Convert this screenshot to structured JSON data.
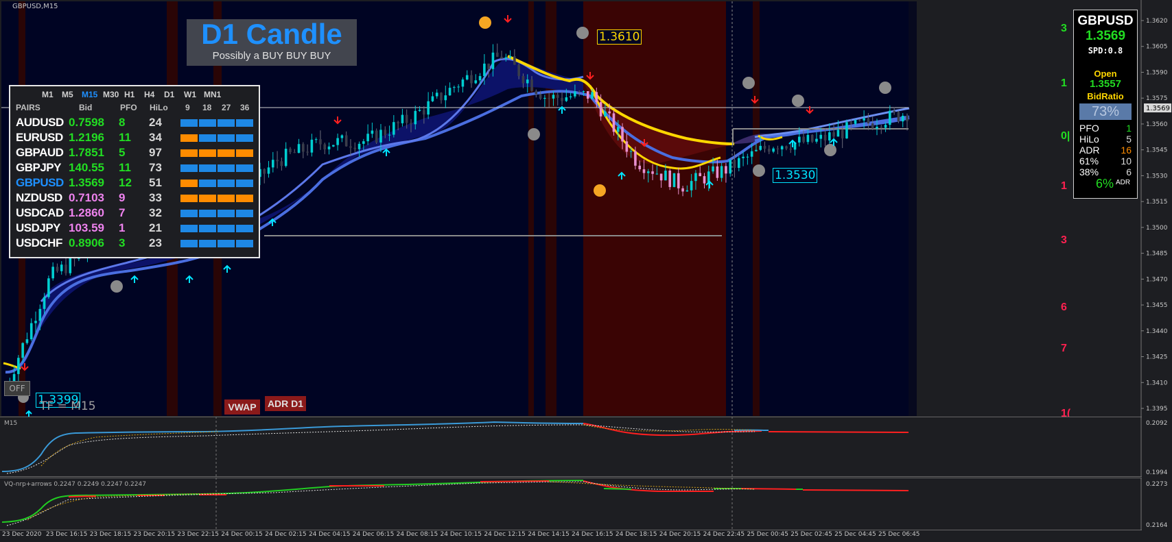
{
  "chart_title": "GBPUSD,M15",
  "banner": {
    "title": "D1 Candle",
    "subtitle": "Possibly a BUY BUY BUY"
  },
  "off_button": "OFF",
  "tf_label": "TF = M15",
  "vwap_button": "VWAP",
  "adr_button": "ADR D1",
  "price_tags": {
    "high": "1.3610",
    "mid": "1.3530",
    "low": "1.3399"
  },
  "right_markers": [
    "3",
    "1",
    "0|",
    "1",
    "3",
    "6",
    "7",
    "1("
  ],
  "price_axis": [
    "1.3620",
    "1.3605",
    "1.3590",
    "1.3575",
    "1.3560",
    "1.3545",
    "1.3530",
    "1.3515",
    "1.3500",
    "1.3485",
    "1.3470",
    "1.3455",
    "1.3440",
    "1.3425",
    "1.3410",
    "1.3395"
  ],
  "current_price_tag": "1.3569",
  "time_axis": [
    "23 Dec 2020",
    "23 Dec 16:15",
    "23 Dec 18:15",
    "23 Dec 20:15",
    "23 Dec 22:15",
    "24 Dec 00:15",
    "24 Dec 02:15",
    "24 Dec 04:15",
    "24 Dec 06:15",
    "24 Dec 08:15",
    "24 Dec 10:15",
    "24 Dec 12:15",
    "24 Dec 14:15",
    "24 Dec 16:15",
    "24 Dec 18:15",
    "24 Dec 20:15",
    "24 Dec 22:45",
    "25 Dec 00:45",
    "25 Dec 02:45",
    "25 Dec 04:45",
    "25 Dec 06:45"
  ],
  "sub1": {
    "title": "M15",
    "axis": [
      "0.2092",
      "0.1994"
    ]
  },
  "sub2": {
    "title": "VQ-nrp+arrows 0.2247 0.2249 0.2247 0.2247",
    "axis": [
      "0.2273",
      "0.2164"
    ]
  },
  "scanner": {
    "timeframes": [
      "M1",
      "M5",
      "M15",
      "M30",
      "H1",
      "H4",
      "D1",
      "W1",
      "MN1"
    ],
    "active_tf": "M15",
    "headers": {
      "pairs": "PAIRS",
      "bid": "Bid",
      "pfo": "PFO",
      "hilo": "HiLo",
      "c9": "9",
      "c18": "18",
      "c27": "27",
      "c36": "36"
    },
    "rows": [
      {
        "pair": "AUDUSD",
        "bid": "0.7598",
        "pfo": "8",
        "hilo": "24",
        "bid_color": "#22dd22",
        "pfo_color": "#22dd22",
        "bars": [
          "#1e88e5",
          "#1e88e5",
          "#1e88e5",
          "#1e88e5"
        ]
      },
      {
        "pair": "EURUSD",
        "bid": "1.2196",
        "pfo": "11",
        "hilo": "34",
        "bid_color": "#22dd22",
        "pfo_color": "#22dd22",
        "bars": [
          "#ff8c00",
          "#1e88e5",
          "#1e88e5",
          "#1e88e5"
        ]
      },
      {
        "pair": "GBPAUD",
        "bid": "1.7851",
        "pfo": "5",
        "hilo": "97",
        "bid_color": "#22dd22",
        "pfo_color": "#22dd22",
        "bars": [
          "#ff8c00",
          "#ff8c00",
          "#ff8c00",
          "#ff8c00"
        ]
      },
      {
        "pair": "GBPJPY",
        "bid": "140.55",
        "pfo": "11",
        "hilo": "73",
        "bid_color": "#22dd22",
        "pfo_color": "#22dd22",
        "bars": [
          "#1e88e5",
          "#1e88e5",
          "#1e88e5",
          "#1e88e5"
        ]
      },
      {
        "pair": "GBPUSD",
        "bid": "1.3569",
        "pfo": "12",
        "hilo": "51",
        "bid_color": "#22dd22",
        "pfo_color": "#22dd22",
        "bars": [
          "#ff8c00",
          "#1e88e5",
          "#1e88e5",
          "#1e88e5"
        ],
        "highlight": "#1e90ff"
      },
      {
        "pair": "NZDUSD",
        "bid": "0.7103",
        "pfo": "9",
        "hilo": "33",
        "bid_color": "#ee82ee",
        "pfo_color": "#ee82ee",
        "bars": [
          "#ff8c00",
          "#ff8c00",
          "#ff8c00",
          "#ff8c00"
        ]
      },
      {
        "pair": "USDCAD",
        "bid": "1.2860",
        "pfo": "7",
        "hilo": "32",
        "bid_color": "#ee82ee",
        "pfo_color": "#ee82ee",
        "bars": [
          "#1e88e5",
          "#1e88e5",
          "#1e88e5",
          "#1e88e5"
        ]
      },
      {
        "pair": "USDJPY",
        "bid": "103.59",
        "pfo": "1",
        "hilo": "21",
        "bid_color": "#ee82ee",
        "pfo_color": "#ee82ee",
        "bars": [
          "#1e88e5",
          "#1e88e5",
          "#1e88e5",
          "#1e88e5"
        ]
      },
      {
        "pair": "USDCHF",
        "bid": "0.8906",
        "pfo": "3",
        "hilo": "23",
        "bid_color": "#22dd22",
        "pfo_color": "#22dd22",
        "bars": [
          "#1e88e5",
          "#1e88e5",
          "#1e88e5",
          "#1e88e5"
        ]
      }
    ]
  },
  "info_panel": {
    "symbol": "GBPUSD",
    "bid": "1.3569",
    "spread": "SPD:0.8",
    "open_label": "Open",
    "open_value": "1.3557",
    "bidratio_label": "BidRatio",
    "bidratio_value": "73%",
    "stats": [
      {
        "label": "PFO",
        "value": "1",
        "color": "#22dd22"
      },
      {
        "label": "HiLo",
        "value": "5",
        "color": "#dddddd"
      },
      {
        "label": "ADR",
        "value": "16",
        "color": "#ff8c00"
      },
      {
        "label": "61%",
        "value": "10",
        "color": "#dddddd"
      },
      {
        "label": "38%",
        "value": "6",
        "color": "#dddddd"
      }
    ],
    "adr_pct": "6%",
    "adr_small": "ADR"
  },
  "colors": {
    "bull_candle": "#00ced1",
    "bear_candle_up": "#2aa4c8",
    "bear_candle_down": "#e890d0",
    "ema_fast": "#ffd700",
    "ema_slow": "#4a6ee0",
    "cloud_bull": "#0a0f6a",
    "cloud_bear": "#4a0808",
    "chart_bg": "#000423"
  },
  "chart_data": {
    "type": "line",
    "title": "GBPUSD,M15",
    "x": [
      "23 Dec 2020",
      "23 Dec 16:15",
      "23 Dec 18:15",
      "23 Dec 20:15",
      "23 Dec 22:15",
      "24 Dec 00:15",
      "24 Dec 02:15",
      "24 Dec 04:15",
      "24 Dec 06:15",
      "24 Dec 08:15",
      "24 Dec 10:15",
      "24 Dec 12:15",
      "24 Dec 14:15",
      "24 Dec 16:15",
      "24 Dec 18:15",
      "24 Dec 20:15",
      "24 Dec 22:45",
      "25 Dec 00:45",
      "25 Dec 02:45",
      "25 Dec 04:45",
      "25 Dec 06:45"
    ],
    "series": [
      {
        "values": [
          1.3402,
          1.347,
          1.3488,
          1.3492,
          1.3495,
          1.3512,
          1.354,
          1.3551,
          1.3552,
          1.3566,
          1.3586,
          1.3604,
          1.3578,
          1.358,
          1.354,
          1.3525,
          1.3535,
          1.355,
          1.3552,
          1.3562,
          1.3569
        ]
      }
    ],
    "ylim": [
      1.339,
      1.3625
    ],
    "current": 1.3569,
    "grid": false
  }
}
